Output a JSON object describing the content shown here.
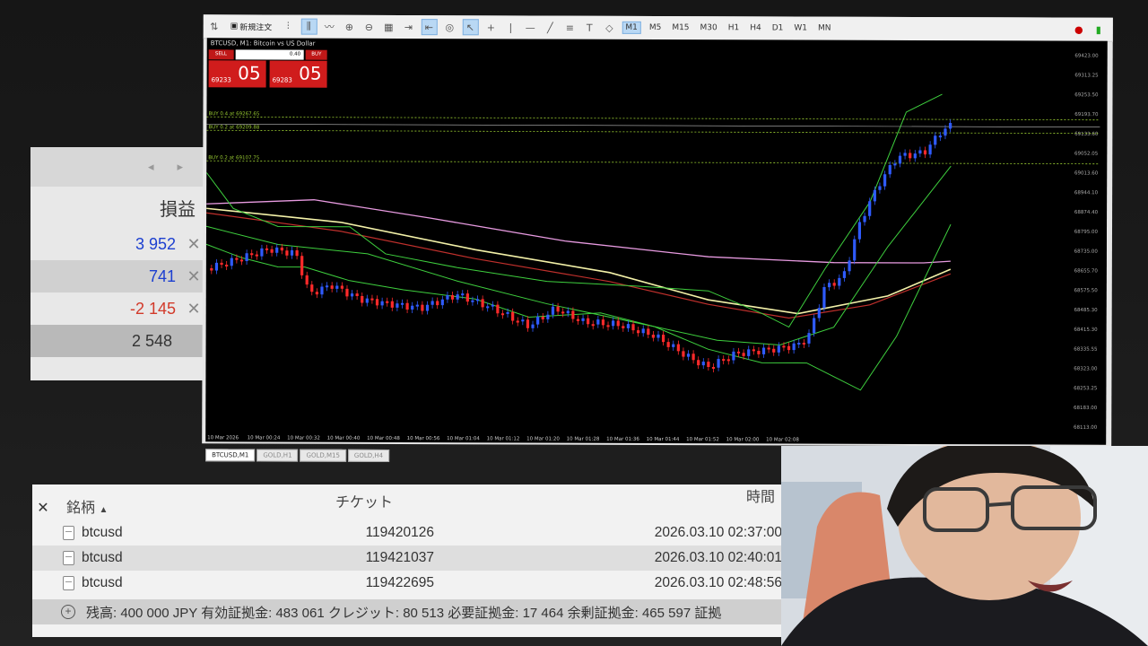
{
  "front_window": {
    "toolbar": {
      "new_order": "新規注文",
      "timeframes": [
        "M1",
        "M5",
        "M15",
        "M30",
        "H1",
        "H4",
        "D1",
        "W1",
        "MN"
      ],
      "active_timeframe": "M1"
    },
    "symbol_title": "BTCUSD, M1: Bitcoin vs US Dollar",
    "one_click": {
      "sell_label": "SELL",
      "buy_label": "BUY",
      "volume": "0.40",
      "sell_small": "69233",
      "sell_big": "05",
      "buy_small": "69283",
      "buy_big": "05"
    },
    "order_lines": [
      {
        "label": "BUY 0.4 at 69267.65"
      },
      {
        "label": "BUY 0.2 at 69209.88"
      },
      {
        "label": "BUY 0.2 at 69107.75"
      }
    ],
    "price_axis": [
      "69423.00",
      "69313.25",
      "69253.50",
      "69193.70",
      "69133.60",
      "69052.05",
      "69013.60",
      "68944.10",
      "68874.40",
      "68795.00",
      "68735.00",
      "68655.70",
      "68575.50",
      "68485.30",
      "68415.30",
      "68335.55",
      "68323.00",
      "68253.25",
      "68183.00",
      "68113.00"
    ],
    "time_axis": [
      "10 Mar 2026",
      "10 Mar 00:24",
      "10 Mar 00:32",
      "10 Mar 00:40",
      "10 Mar 00:48",
      "10 Mar 00:56",
      "10 Mar 01:04",
      "10 Mar 01:12",
      "10 Mar 01:20",
      "10 Mar 01:28",
      "10 Mar 01:36",
      "10 Mar 01:44",
      "10 Mar 01:52",
      "10 Mar 02:00",
      "10 Mar 02:08"
    ],
    "tabs": [
      "BTCUSD,M1",
      "GOLD,H1",
      "GOLD,M15",
      "GOLD,H4"
    ],
    "active_tab": "BTCUSD,M1"
  },
  "back_window": {
    "pl_header": "損益",
    "pl_rows": [
      {
        "value": "3 952",
        "kind": "pos"
      },
      {
        "value": "741",
        "kind": "pos"
      },
      {
        "value": "-2 145",
        "kind": "neg"
      }
    ],
    "pl_total": "2 548",
    "close_glyph": "✕"
  },
  "trade_table": {
    "close_glyph": "✕",
    "headers": {
      "symbol": "銘柄",
      "ticket": "チケット",
      "time": "時間"
    },
    "rows": [
      {
        "symbol": "btcusd",
        "ticket": "119420126",
        "time": "2026.03.10 02:37:00"
      },
      {
        "symbol": "btcusd",
        "ticket": "119421037",
        "time": "2026.03.10 02:40:01"
      },
      {
        "symbol": "btcusd",
        "ticket": "119422695",
        "time": "2026.03.10 02:48:56"
      }
    ],
    "balance_line": "残高: 400 000 JPY  有効証拠金: 483 061  クレジット: 80 513  必要証拠金: 17 464  余剰証拠金: 465 597  証拠"
  },
  "colors": {
    "bull": "#2f5bff",
    "bear": "#ff2a2a",
    "bollinger": "#3ecf3e",
    "ma_slow": "#e79ae0",
    "ma_mid": "#f3f1a8",
    "ma_fast": "#c0302c",
    "order_line": "#9acd32"
  }
}
